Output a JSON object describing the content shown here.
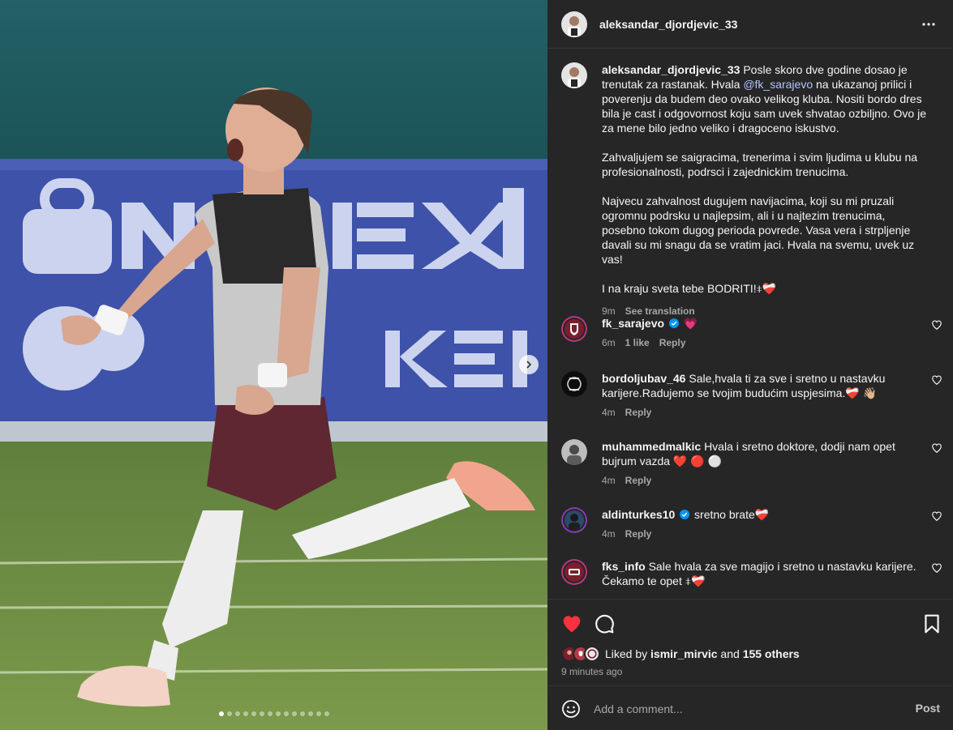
{
  "post": {
    "username": "aleksandar_djordjevic_33",
    "caption_lines": [
      "Posle skoro dve godine dosao je trenutak za rastanak. Hvala ",
      "@fk_sarajevo",
      " na ukazanoj prilici i poverenju da budem deo ovako velikog kluba. Nositi bordo dres bila je cast i odgovornost koju sam uvek shvatao ozbiljno. Ovo je za mene bilo jedno veliko i dragoceno iskustvo.\n\nZahvaljujem se saigracima, trenerima i svim ljudima u klubu na profesionalnosti, podrsci i zajednickim trenucima.\n\nNajvecu zahvalnost dugujem navijacima, koji su mi pruzali ogromnu podrsku u najlepsim, ali i u najtezim trenucima, posebno tokom dugog perioda povrede. Vasa vera i strpljenje davali su mi snagu da se vratim jaci. Hvala na svemu, uvek uz vas!\n\nI na kraju sveta tebe BODRITI!⧧❤️‍🩹"
    ],
    "caption_time": "9m",
    "see_translation": "See translation"
  },
  "comments": [
    {
      "user": "fk_sarajevo",
      "verified": true,
      "text": "💗",
      "time": "6m",
      "likes": "1 like",
      "reply": "Reply"
    },
    {
      "user": "bordoljubav_46",
      "verified": false,
      "text": "Sale,hvala ti za sve i sretno u nastavku karijere.Radujemo se tvojim budućim uspjesima.❤️‍🩹 👋🏼",
      "time": "4m",
      "reply": "Reply"
    },
    {
      "user": "muhammedmalkic",
      "verified": false,
      "text": "Hvala i sretno doktore, dodji nam opet bujrum vazda ❤️ 🔴 ⚪",
      "time": "4m",
      "reply": "Reply"
    },
    {
      "user": "aldinturkes10",
      "verified": true,
      "text": "sretno brate❤️‍🩹",
      "time": "4m",
      "reply": "Reply"
    },
    {
      "user": "fks_info",
      "verified": false,
      "text": "Sale hvala za sve magijo i sretno u nastavku karijere. Čekamo te opet ⧧❤️‍🩹",
      "time": "",
      "reply": ""
    }
  ],
  "likes": {
    "prefix": "Liked by ",
    "user": "ismir_mirvic",
    "middle": " and ",
    "others": "155 others"
  },
  "time_ago": "9 minutes ago",
  "add_comment": {
    "placeholder": "Add a comment...",
    "post_label": "Post"
  },
  "carousel": {
    "count": 14,
    "active_index": 0
  },
  "colors": {
    "accent_link": "#b5c3ff",
    "like_red": "#ff3040",
    "verified_blue": "#0095f6",
    "panel_bg": "#262626"
  }
}
